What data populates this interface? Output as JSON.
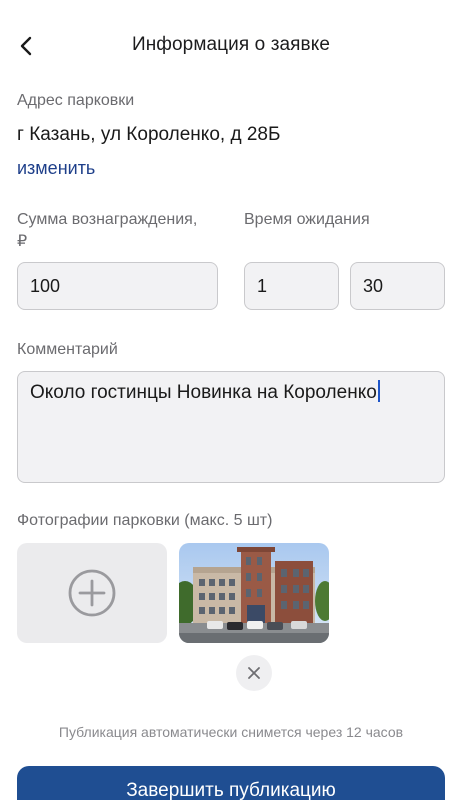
{
  "header": {
    "title": "Информация о заявке",
    "back_icon": "chevron-left-icon"
  },
  "address": {
    "label": "Адрес парковки",
    "value": "г Казань, ул Короленко, д 28Б",
    "change_link": "изменить"
  },
  "reward": {
    "label": "Сумма вознаграждения, ₽",
    "value": "100"
  },
  "wait_time": {
    "label": "Время ожидания",
    "hours": "1",
    "minutes": "30"
  },
  "comment": {
    "label": "Комментарий",
    "value": "Около гостинцы Новинка на Короленко"
  },
  "photos": {
    "label": "Фотографии парковки (макс. 5 шт)",
    "add_icon": "plus-circle-icon",
    "remove_icon": "close-icon",
    "count": 1
  },
  "notice": "Публикация автоматически снимется через 12 часов",
  "finish_button": "Завершить публикацию",
  "colors": {
    "accent": "#1f4e92",
    "link": "#1e3f8a",
    "field_bg": "#f2f2f4"
  }
}
